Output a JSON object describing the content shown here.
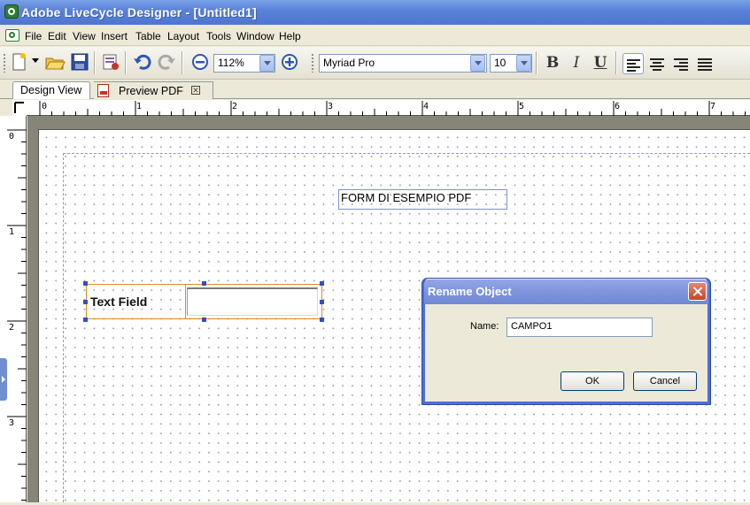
{
  "window": {
    "title": "Adobe LiveCycle Designer - [Untitled1]"
  },
  "menu": [
    "File",
    "Edit",
    "View",
    "Insert",
    "Table",
    "Layout",
    "Tools",
    "Window",
    "Help"
  ],
  "toolbar": {
    "zoom": "112%",
    "font_family": "Myriad Pro",
    "font_size": "10",
    "bold": "B",
    "italic": "I",
    "underline": "U",
    "icons": [
      "new-document-icon",
      "open-folder-icon",
      "save-icon",
      "preview-icon",
      "undo-icon",
      "redo-icon",
      "zoom-out-icon",
      "zoom-in-icon",
      "align-left-icon",
      "align-center-icon",
      "align-right-icon",
      "justify-icon"
    ]
  },
  "tabs": [
    "Design View",
    "Preview PDF"
  ],
  "rulers": {
    "horizontal": [
      "0",
      "1",
      "2",
      "3",
      "4",
      "5",
      "6",
      "7"
    ],
    "vertical": [
      "0",
      "1",
      "2",
      "3"
    ]
  },
  "canvas": {
    "form_title": "FORM DI ESEMPIO PDF",
    "text_field_caption": "Text Field"
  },
  "dialog": {
    "title": "Rename Object",
    "name_label": "Name:",
    "name_value": "CAMPO1",
    "ok": "OK",
    "cancel": "Cancel"
  },
  "colors": {
    "title_bar": "#5b82d8",
    "selection_border": "#e08a1e",
    "selection_handle": "#3050c8",
    "dialog_border": "#4d6fd3"
  }
}
